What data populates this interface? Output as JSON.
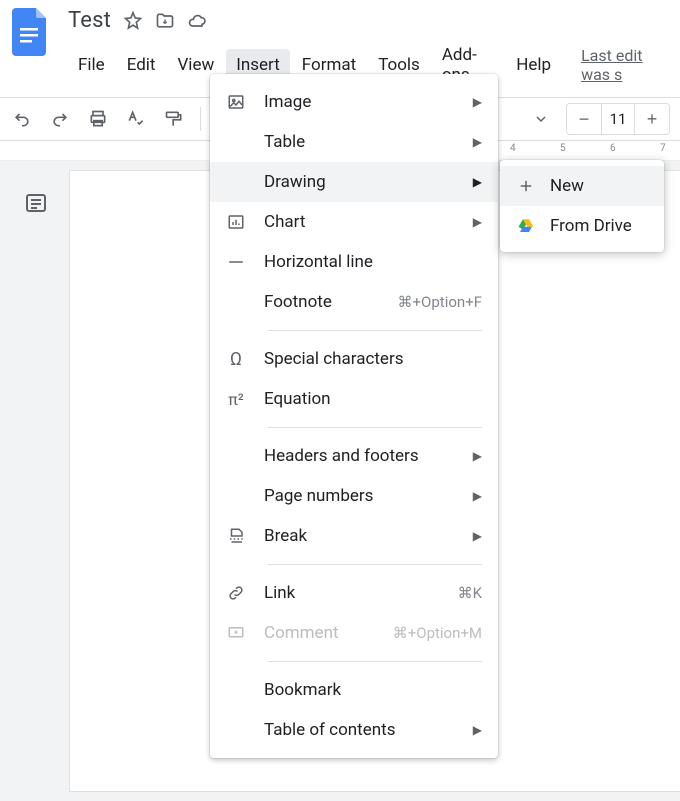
{
  "header": {
    "title": "Test",
    "last_edit": "Last edit was s"
  },
  "menu": {
    "file": "File",
    "edit": "Edit",
    "view": "View",
    "insert": "Insert",
    "format": "Format",
    "tools": "Tools",
    "addons": "Add-ons",
    "help": "Help"
  },
  "toolbar": {
    "font_size": "11"
  },
  "ruler": {
    "m4": "4",
    "m5": "5",
    "m6": "6",
    "m7": "7"
  },
  "insert_menu": {
    "image": "Image",
    "table": "Table",
    "drawing": "Drawing",
    "chart": "Chart",
    "hline": "Horizontal line",
    "footnote": "Footnote",
    "footnote_sc": "⌘+Option+F",
    "special": "Special characters",
    "equation": "Equation",
    "headers_footers": "Headers and footers",
    "page_numbers": "Page numbers",
    "break": "Break",
    "link": "Link",
    "link_sc": "⌘K",
    "comment": "Comment",
    "comment_sc": "⌘+Option+M",
    "bookmark": "Bookmark",
    "toc": "Table of contents"
  },
  "drawing_submenu": {
    "new": "New",
    "from_drive": "From Drive"
  }
}
